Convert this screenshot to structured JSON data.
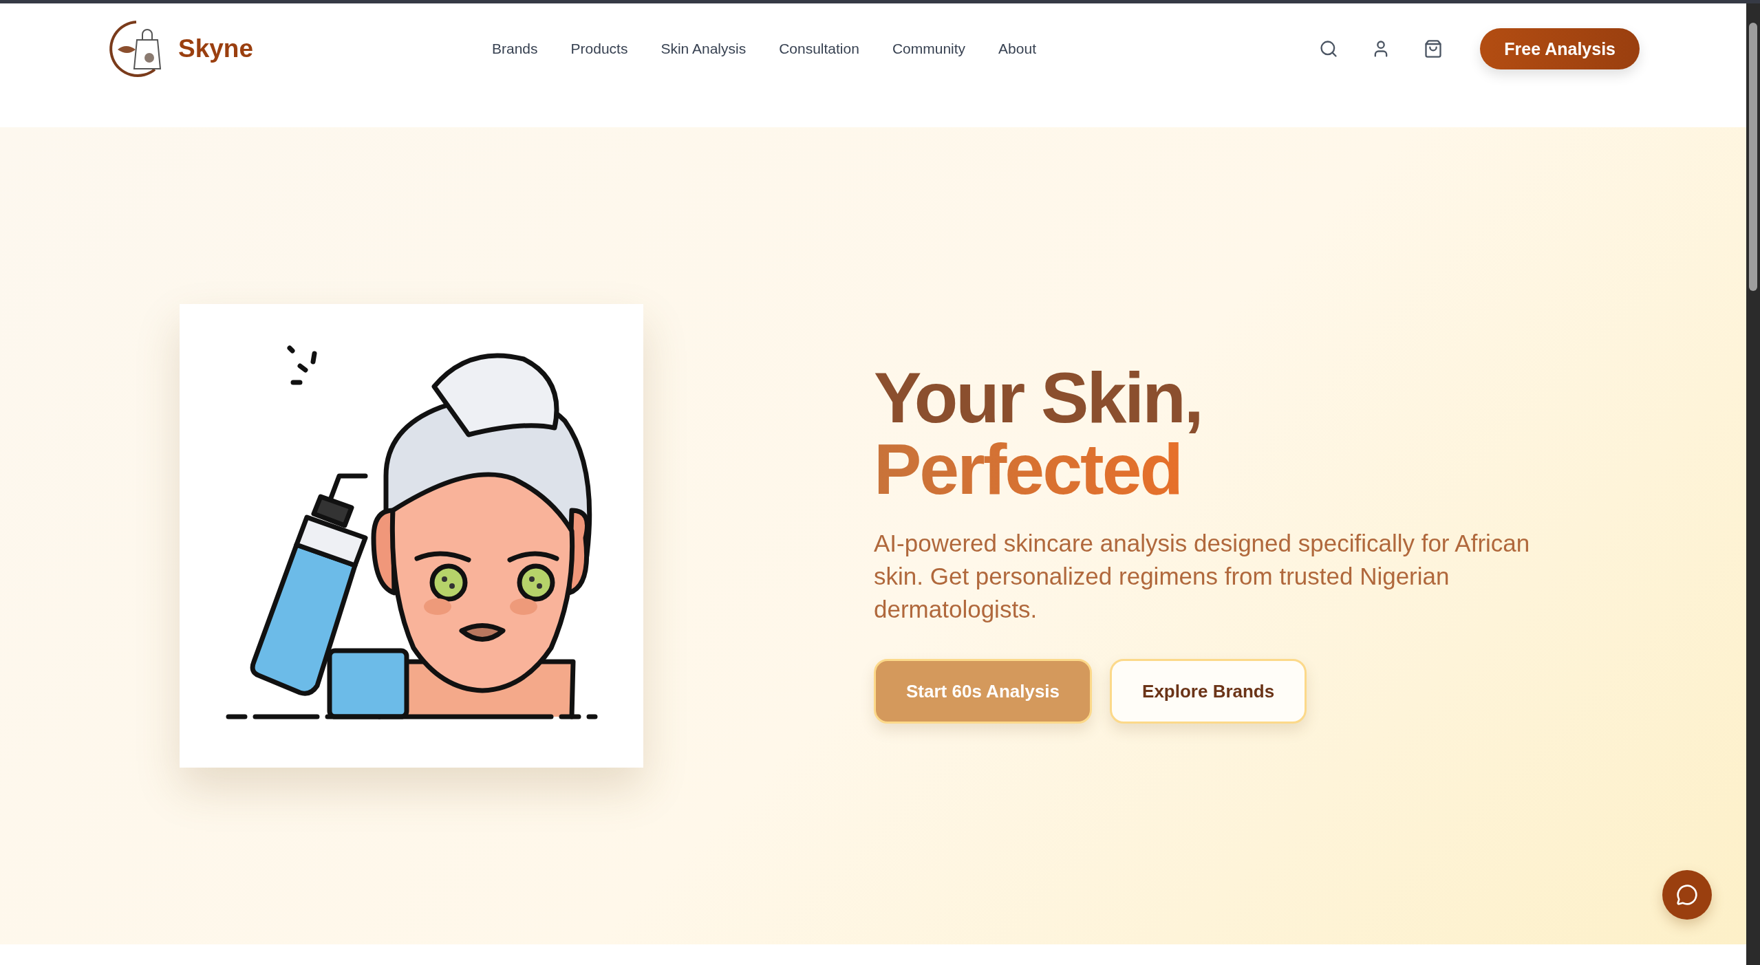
{
  "header": {
    "brand": "Skyne",
    "nav": [
      {
        "label": "Brands"
      },
      {
        "label": "Products"
      },
      {
        "label": "Skin Analysis"
      },
      {
        "label": "Consultation"
      },
      {
        "label": "Community"
      },
      {
        "label": "About"
      }
    ],
    "cta": "Free Analysis"
  },
  "hero": {
    "title_line_1": "Your Skin,",
    "title_line_2": "Perfected",
    "description": "AI-powered skincare analysis designed specifically for African skin. Get personalized regimens from trusted Nigerian dermatologists.",
    "buttons": [
      {
        "label": "Start 60s Analysis",
        "kind": "primary"
      },
      {
        "label": "Explore Brands",
        "kind": "secondary"
      }
    ]
  }
}
